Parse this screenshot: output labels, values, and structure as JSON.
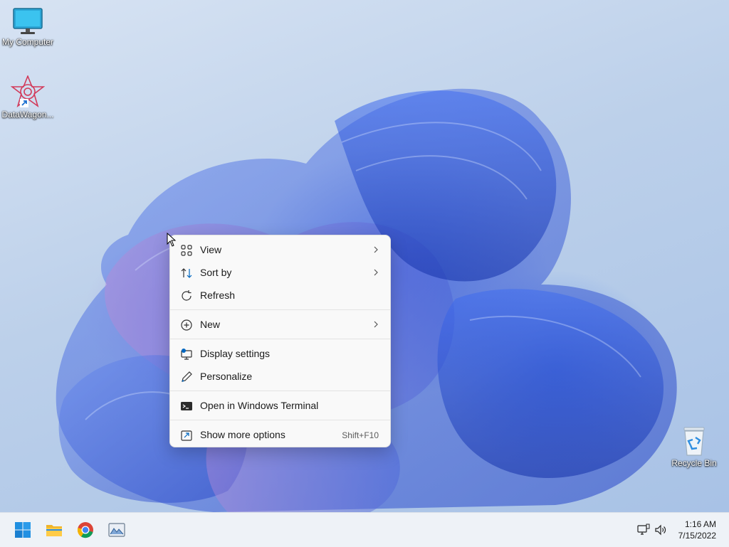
{
  "desktop": {
    "icons": [
      {
        "label": "My Computer",
        "icon": "monitor-icon"
      },
      {
        "label": "DataWagon...",
        "icon": "datawagon-icon"
      },
      {
        "label": "Recycle Bin",
        "icon": "recycle-bin-icon"
      }
    ]
  },
  "context_menu": {
    "items": [
      {
        "label": "View",
        "icon": "grid-icon",
        "submenu": true
      },
      {
        "label": "Sort by",
        "icon": "sort-icon",
        "submenu": true
      },
      {
        "label": "Refresh",
        "icon": "refresh-icon"
      },
      {
        "label": "New",
        "icon": "plus-circle-icon",
        "submenu": true
      },
      {
        "label": "Display settings",
        "icon": "display-settings-icon"
      },
      {
        "label": "Personalize",
        "icon": "pen-icon"
      },
      {
        "label": "Open in Windows Terminal",
        "icon": "terminal-icon"
      },
      {
        "label": "Show more options",
        "icon": "more-options-icon",
        "shortcut": "Shift+F10"
      }
    ]
  },
  "taskbar": {
    "pinned": [
      "start-icon",
      "file-explorer-icon",
      "chrome-icon",
      "image-viewer-icon"
    ],
    "tray": [
      "network-icon",
      "volume-icon"
    ],
    "time": "1:16 AM",
    "date": "7/15/2022"
  },
  "colors": {
    "accent": "#0067c0",
    "menu_bg": "#f9f9f9",
    "taskbar_bg": "#eef2f7"
  }
}
